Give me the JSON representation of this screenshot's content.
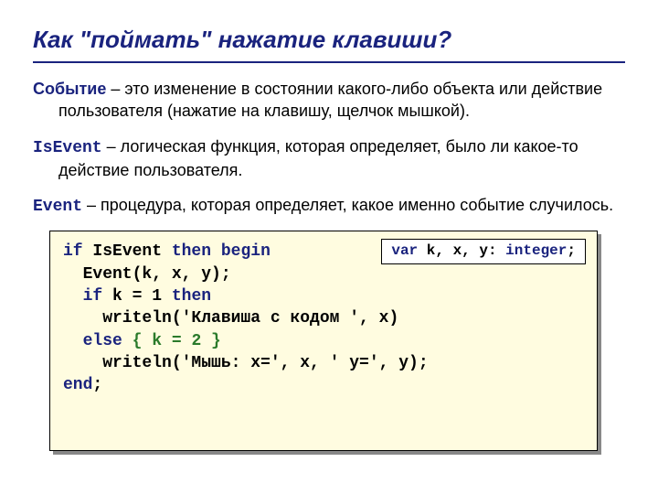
{
  "title": "Как \"поймать\" нажатие клавиши?",
  "para1": {
    "term": "Событие",
    "rest": " – это изменение в состоянии какого-либо объекта или действие пользователя (нажатие на клавишу, щелчок мышкой)."
  },
  "para2": {
    "term": "IsEvent",
    "rest": " – логическая функция, которая определяет, было ли какое-то действие пользователя."
  },
  "para3": {
    "term": "Event",
    "rest": " – процедура, которая определяет, какое именно событие случилось."
  },
  "code": {
    "l1a": "if",
    "l1b": " IsEvent ",
    "l1c": "then",
    "l1d": " ",
    "l1e": "begin",
    "l2a": "  Event(k, x, y);",
    "l3a": "  ",
    "l3b": "if",
    "l3c": " k = 1 ",
    "l3d": "then",
    "l4a": "    writeln('Клавиша с кодом ', x)",
    "l5a": "  ",
    "l5b": "else",
    "l5c": " ",
    "l5d": "{ k = 2 }",
    "l6a": "    writeln('Мышь: x=', x, ' y=', y);",
    "l7a": "end",
    "l7b": ";"
  },
  "varbox": {
    "kw1": "var",
    "mid": " k, x, y: ",
    "kw2": "integer",
    "end": ";"
  }
}
